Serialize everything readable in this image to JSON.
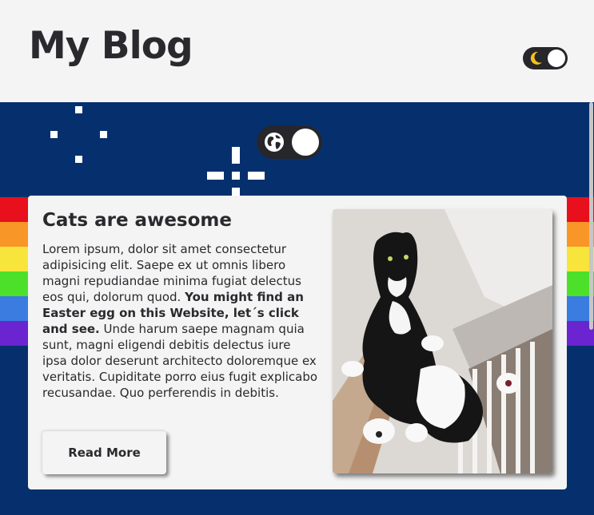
{
  "header": {
    "title": "My Blog",
    "theme_toggle_icon": "moon-icon",
    "theme_toggle_state": "off"
  },
  "hero": {
    "globe_toggle_icon": "globe-icon",
    "globe_toggle_state": "off",
    "rainbow_colors": [
      "#e8101d",
      "#f99628",
      "#f7e53b",
      "#4ce02b",
      "#3a7ce0",
      "#6a24d0"
    ],
    "background_color": "#06306d"
  },
  "post": {
    "title": "Cats are awesome",
    "text_before": "Lorem ipsum, dolor sit amet consectetur adipisicing elit. Saepe ex ut omnis libero magni repudiandae minima fugiat delectus eos qui, dolorum quod. ",
    "text_bold": "You might find an Easter egg on this Website, let´s click and see.",
    "text_after": " Unde harum saepe magnam quia sunt, magni eligendi debitis delectus iure ipsa dolor deserunt architecto doloremque ex veritatis. Cupiditate porro eius fugit explicabo recusandae. Quo perferendis in debitis.",
    "button_label": "Read More",
    "image_subject": "black-and-white cat held up by a hand"
  }
}
